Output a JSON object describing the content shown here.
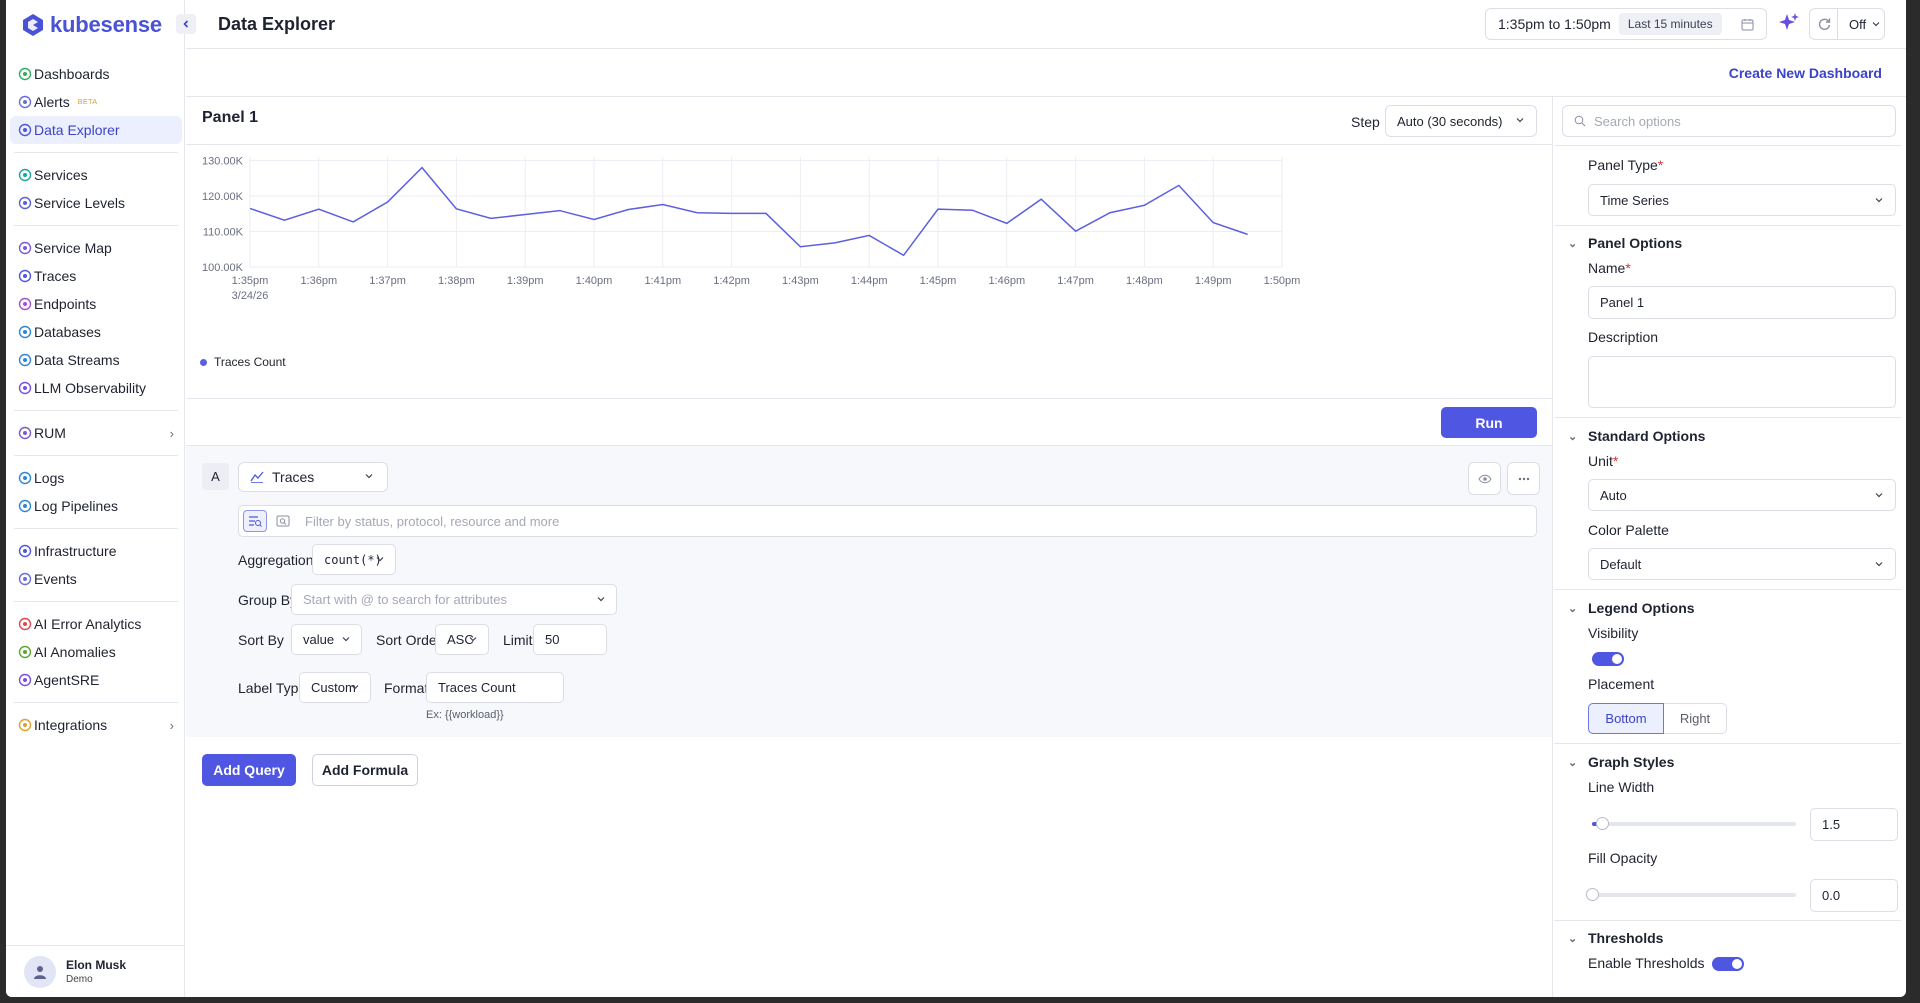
{
  "app": {
    "name": "kubesense"
  },
  "sidebar": {
    "groups": [
      [
        {
          "label": "Dashboards",
          "icon": "dashboard-icon"
        },
        {
          "label": "Alerts",
          "icon": "alert-icon",
          "badge": "BETA"
        },
        {
          "label": "Data Explorer",
          "icon": "data-explorer-icon",
          "active": true
        }
      ],
      [
        {
          "label": "Services",
          "icon": "services-icon"
        },
        {
          "label": "Service Levels",
          "icon": "service-levels-icon"
        }
      ],
      [
        {
          "label": "Service Map",
          "icon": "service-map-icon"
        },
        {
          "label": "Traces",
          "icon": "traces-icon"
        },
        {
          "label": "Endpoints",
          "icon": "endpoints-icon"
        },
        {
          "label": "Databases",
          "icon": "databases-icon"
        },
        {
          "label": "Data Streams",
          "icon": "data-streams-icon"
        },
        {
          "label": "LLM Observability",
          "icon": "llm-icon"
        }
      ],
      [
        {
          "label": "RUM",
          "icon": "rum-icon",
          "expandable": true
        }
      ],
      [
        {
          "label": "Logs",
          "icon": "logs-icon"
        },
        {
          "label": "Log Pipelines",
          "icon": "log-pipelines-icon"
        }
      ],
      [
        {
          "label": "Infrastructure",
          "icon": "infrastructure-icon"
        },
        {
          "label": "Events",
          "icon": "events-icon"
        }
      ],
      [
        {
          "label": "AI Error Analytics",
          "icon": "ai-error-icon"
        },
        {
          "label": "AI Anomalies",
          "icon": "ai-anomalies-icon"
        },
        {
          "label": "AgentSRE",
          "icon": "agent-sre-icon"
        }
      ],
      [
        {
          "label": "Integrations",
          "icon": "integrations-icon",
          "expandable": true
        }
      ]
    ],
    "user": {
      "name": "Elon Musk",
      "role": "Demo"
    }
  },
  "header": {
    "title": "Data Explorer",
    "time_range": "1:35pm to 1:50pm",
    "time_preset": "Last 15 minutes",
    "refresh": "Off",
    "create_link": "Create New Dashboard"
  },
  "panel": {
    "title": "Panel 1",
    "step_label": "Step",
    "step_value": "Auto (30 seconds)",
    "run_label": "Run"
  },
  "chart_data": {
    "type": "line",
    "x": [
      "1:35pm",
      "1:35:30",
      "1:36pm",
      "1:36:30",
      "1:37pm",
      "1:37:30",
      "1:38pm",
      "1:38:30",
      "1:39pm",
      "1:39:30",
      "1:40pm",
      "1:40:30",
      "1:41pm",
      "1:41:30",
      "1:42pm",
      "1:42:30",
      "1:43pm",
      "1:43:30",
      "1:44pm",
      "1:44:30",
      "1:45pm",
      "1:45:30",
      "1:46pm",
      "1:46:30",
      "1:47pm",
      "1:47:30",
      "1:48pm",
      "1:48:30",
      "1:49pm",
      "1:49:30"
    ],
    "series": [
      {
        "name": "Traces Count",
        "color": "#5b5fe0",
        "values": [
          116500,
          113200,
          116300,
          112700,
          118300,
          128000,
          116400,
          113700,
          114800,
          115900,
          113400,
          116200,
          117600,
          115300,
          115100,
          115100,
          105700,
          106800,
          108900,
          103300,
          116300,
          116000,
          112300,
          119100,
          110100,
          115300,
          117400,
          123000,
          112500,
          109200
        ]
      }
    ],
    "xticks": [
      "1:35pm",
      "1:36pm",
      "1:37pm",
      "1:38pm",
      "1:39pm",
      "1:40pm",
      "1:41pm",
      "1:42pm",
      "1:43pm",
      "1:44pm",
      "1:45pm",
      "1:46pm",
      "1:47pm",
      "1:48pm",
      "1:49pm",
      "1:50pm"
    ],
    "xdate": "3/24/26",
    "yticks": [
      "130.00K",
      "120.00K",
      "110.00K",
      "100.00K"
    ],
    "ytick_values": [
      130000,
      120000,
      110000,
      100000
    ],
    "ylim": [
      100000,
      131000
    ],
    "grid": true,
    "legend": "bottom-left"
  },
  "query": {
    "letter": "A",
    "source": "Traces",
    "filter_placeholder": "Filter by status, protocol, resource and more",
    "aggregations_label": "Aggregations",
    "aggregation": "count(*)",
    "group_by_label": "Group By",
    "group_by_placeholder": "Start with @ to search for attributes",
    "sort_by_label": "Sort By",
    "sort_by": "value",
    "sort_order_label": "Sort Order",
    "sort_order": "ASC",
    "limit_label": "Limit",
    "limit": "50",
    "label_type_label": "Label Type",
    "label_type": "Custom",
    "format_label": "Format",
    "format": "Traces Count",
    "format_hint": "Ex: {{workload}}",
    "add_query": "Add Query",
    "add_formula": "Add Formula"
  },
  "options": {
    "search_placeholder": "Search options",
    "panel_type_label": "Panel Type",
    "panel_type": "Time Series",
    "panel_options": "Panel Options",
    "name_label": "Name",
    "name_value": "Panel 1",
    "description_label": "Description",
    "standard_options": "Standard Options",
    "unit_label": "Unit",
    "unit": "Auto",
    "palette_label": "Color Palette",
    "palette": "Default",
    "legend_options": "Legend Options",
    "visibility_label": "Visibility",
    "legend_visible": true,
    "placement_label": "Placement",
    "placement_bottom": "Bottom",
    "placement_right": "Right",
    "graph_styles": "Graph Styles",
    "line_width_label": "Line Width",
    "line_width": "1.5",
    "line_width_level": 0.05,
    "fill_opacity_label": "Fill Opacity",
    "fill_opacity": "0.0",
    "fill_opacity_level": 0.0,
    "thresholds": "Thresholds",
    "enable_thresholds_label": "Enable Thresholds",
    "thresholds_enabled": true
  }
}
